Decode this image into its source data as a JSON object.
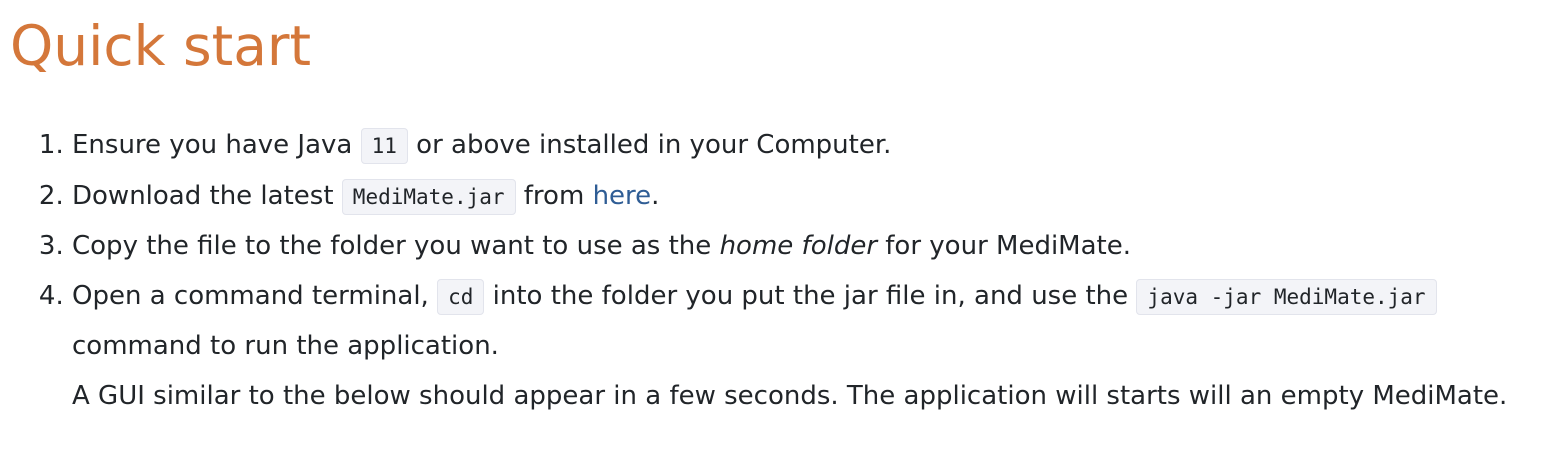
{
  "heading": {
    "title": "Quick start"
  },
  "steps": [
    {
      "number": "1.",
      "text_before": "Ensure you have Java ",
      "code": "11",
      "text_after": " or above installed in your Computer."
    },
    {
      "number": "2.",
      "text_before": "Download the latest ",
      "code": "MediMate.jar",
      "text_middle": " from ",
      "link": "here",
      "text_after": "."
    },
    {
      "number": "3.",
      "text_before": "Copy the file to the folder you want to use as the ",
      "emphasis": "home folder",
      "text_after": " for your MediMate."
    },
    {
      "number": "4.",
      "text_before": "Open a command terminal, ",
      "code_1": "cd",
      "text_middle": " into the folder you put the jar file in, and use the ",
      "code_2": "java -jar MediMate.jar",
      "text_after": " command to run the application.",
      "note": "A GUI similar to the below should appear in a few seconds. The application will starts will an empty MediMate."
    }
  ],
  "colors": {
    "heading": "#d4773a",
    "body_text": "#212529",
    "link": "#2f5d95",
    "code_background": "#f3f4f8",
    "code_border": "#e2e4ec"
  }
}
